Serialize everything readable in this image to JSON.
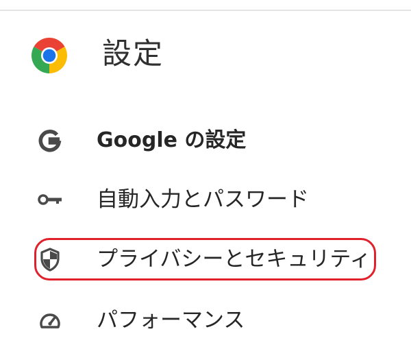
{
  "header": {
    "title": "設定",
    "logo_icon": "chrome-logo-icon"
  },
  "nav": {
    "items": [
      {
        "label": "Google の設定",
        "icon": "google-g-icon"
      },
      {
        "label": "自動入力とパスワード",
        "icon": "key-icon"
      },
      {
        "label": "プライバシーとセキュリティ",
        "icon": "shield-icon",
        "highlighted": true
      },
      {
        "label": "パフォーマンス",
        "icon": "speedometer-icon"
      }
    ]
  },
  "colors": {
    "highlight": "#e0202a",
    "text": "#262626",
    "icon": "#4a4a4a",
    "chrome_red": "#ea4335",
    "chrome_yellow": "#fbbc04",
    "chrome_green": "#34a853",
    "chrome_blue": "#1a73e8"
  }
}
